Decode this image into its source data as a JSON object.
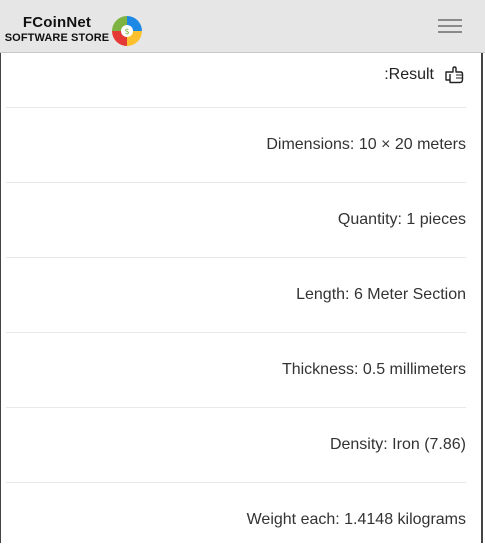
{
  "header": {
    "brand_name": "FCoinNet",
    "brand_sub": "SOFTWARE STORE",
    "logo_icon": "pinwheel-logo-icon",
    "menu_icon": "hamburger-menu-icon"
  },
  "result": {
    "title": ":Result",
    "title_icon": "pointing-hand-icon",
    "rows": [
      {
        "text": "Dimensions: 10 × 20 meters"
      },
      {
        "text": "Quantity: 1 pieces"
      },
      {
        "text": "Length: 6 Meter Section"
      },
      {
        "text": "Thickness: 0.5 millimeters"
      },
      {
        "text": "Density: Iron (7.86)"
      },
      {
        "text": "Weight each: 1.4148 kilograms"
      }
    ]
  },
  "colors": {
    "header_bg": "#e6e6e6",
    "text": "#333333",
    "logo_red": "#e53935",
    "logo_green": "#7cb342",
    "logo_blue": "#1e88e5",
    "logo_yellow": "#fbc02d"
  }
}
